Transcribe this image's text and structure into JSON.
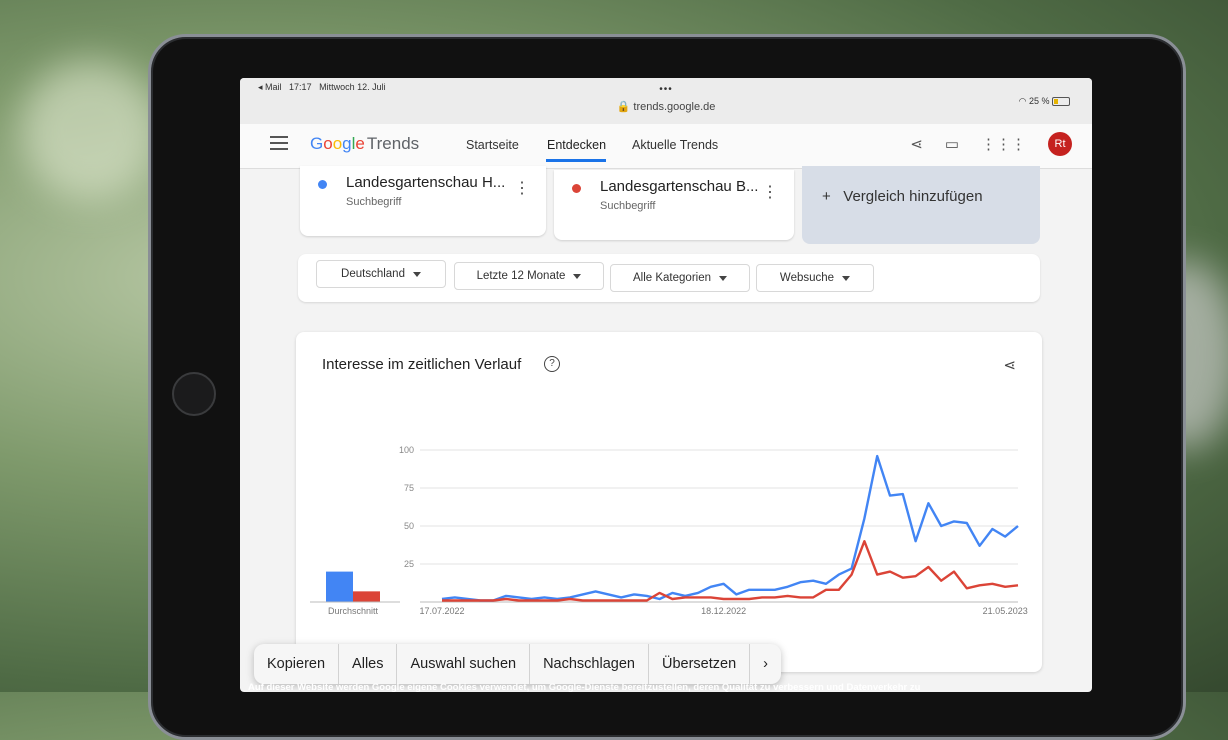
{
  "status_bar": {
    "back_app": "◂ Mail",
    "time": "17:17",
    "date": "Mittwoch 12. Juli",
    "url": "trends.google.de",
    "battery": "25 %"
  },
  "app": {
    "logo_google": [
      "G",
      "o",
      "o",
      "g",
      "l",
      "e"
    ],
    "logo_trends": "Trends",
    "nav": [
      "Startseite",
      "Entdecken",
      "Aktuelle Trends"
    ],
    "active_nav": "Entdecken",
    "avatar": "Rt"
  },
  "terms": [
    {
      "name": "Landesgartenschau H...",
      "sub": "Suchbegriff",
      "color": "#4285f4"
    },
    {
      "name": "Landesgartenschau B...",
      "sub": "Suchbegriff",
      "color": "#db4437"
    }
  ],
  "compare_label": "Vergleich hinzufügen",
  "filters": [
    "Deutschland",
    "Letzte 12 Monate",
    "Alle Kategorien",
    "Websuche"
  ],
  "card_title": "Interesse im zeitlichen Verlauf",
  "chart_data": {
    "type": "line",
    "yticks": [
      100,
      75,
      50,
      25
    ],
    "ylim": [
      0,
      100
    ],
    "xticks": [
      "17.07.2022",
      "18.12.2022",
      "21.05.2023"
    ],
    "x_tick_positions": [
      0,
      22,
      44
    ],
    "averages_label": "Durchschnitt",
    "averages": [
      20,
      7
    ],
    "series": [
      {
        "color": "#4285f4",
        "values": [
          2,
          3,
          2,
          1,
          1,
          4,
          3,
          2,
          3,
          2,
          3,
          5,
          7,
          5,
          3,
          5,
          4,
          2,
          6,
          4,
          6,
          10,
          12,
          5,
          8,
          8,
          8,
          10,
          13,
          14,
          12,
          18,
          22,
          55,
          96,
          70,
          71,
          40,
          65,
          50,
          53,
          52,
          37,
          48,
          43,
          50
        ]
      },
      {
        "color": "#db4437",
        "values": [
          1,
          1,
          1,
          1,
          1,
          2,
          1,
          1,
          1,
          1,
          2,
          1,
          1,
          1,
          1,
          1,
          1,
          6,
          2,
          3,
          3,
          3,
          2,
          2,
          2,
          3,
          3,
          4,
          3,
          3,
          8,
          8,
          18,
          40,
          18,
          20,
          16,
          17,
          23,
          14,
          20,
          9,
          11,
          12,
          10,
          11
        ]
      }
    ]
  },
  "context_menu": [
    "Kopieren",
    "Alles",
    "Auswahl suchen",
    "Nachschlagen",
    "Übersetzen",
    "›"
  ],
  "cookie_text": "Auf dieser Website werden Google eigene Cookies verwendet, um Google-Dienste bereitzustellen, deren Qualität zu verbessern und Datenverkehr zu"
}
